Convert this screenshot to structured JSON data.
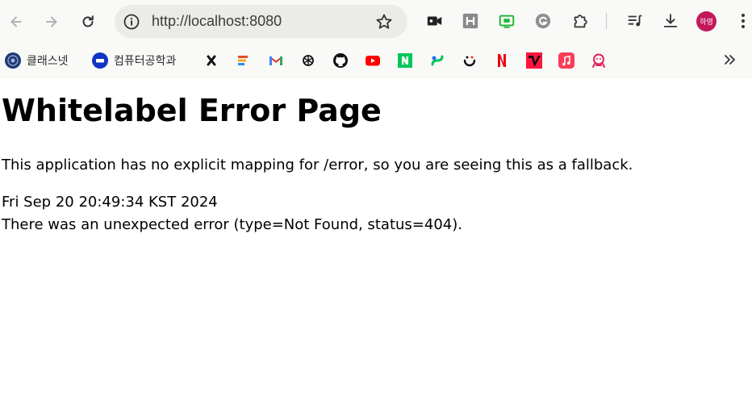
{
  "toolbar": {
    "url": "http://localhost:8080",
    "avatar_text": "하영",
    "icons": [
      "back-icon",
      "forward-icon",
      "reload-icon",
      "site-info-icon",
      "bookmark-star-icon",
      "video-camera-icon",
      "h-extension-icon",
      "green-extension-icon",
      "grammarly-icon",
      "extensions-puzzle-icon",
      "media-queue-icon",
      "download-icon",
      "profile-avatar",
      "more-menu-icon"
    ]
  },
  "bookmarks": {
    "items": [
      {
        "label": "클래스넷",
        "icon": "university-seal-icon"
      },
      {
        "label": "컴퓨터공학과",
        "icon": "department-icon"
      },
      {
        "label": "",
        "icon": "notion-like-icon"
      },
      {
        "label": "",
        "icon": "stack-icon"
      },
      {
        "label": "",
        "icon": "gmail-icon"
      },
      {
        "label": "",
        "icon": "chatgpt-icon"
      },
      {
        "label": "",
        "icon": "github-icon"
      },
      {
        "label": "",
        "icon": "youtube-icon"
      },
      {
        "label": "",
        "icon": "naver-icon"
      },
      {
        "label": "",
        "icon": "naver-map-icon"
      },
      {
        "label": "",
        "icon": "smile-icon"
      },
      {
        "label": "",
        "icon": "netflix-icon"
      },
      {
        "label": "",
        "icon": "tving-icon"
      },
      {
        "label": "",
        "icon": "apple-music-icon"
      },
      {
        "label": "",
        "icon": "pink-character-icon"
      }
    ],
    "overflow": "»"
  },
  "page": {
    "title": "Whitelabel Error Page",
    "message": "This application has no explicit mapping for /error, so you are seeing this as a fallback.",
    "timestamp": "Fri Sep 20 20:49:34 KST 2024",
    "detail": "There was an unexpected error (type=Not Found, status=404)."
  },
  "colors": {
    "chrome_bg": "#f9f9f7",
    "omnibox_bg": "#ebebe7",
    "avatar_bg": "#c2185b"
  }
}
